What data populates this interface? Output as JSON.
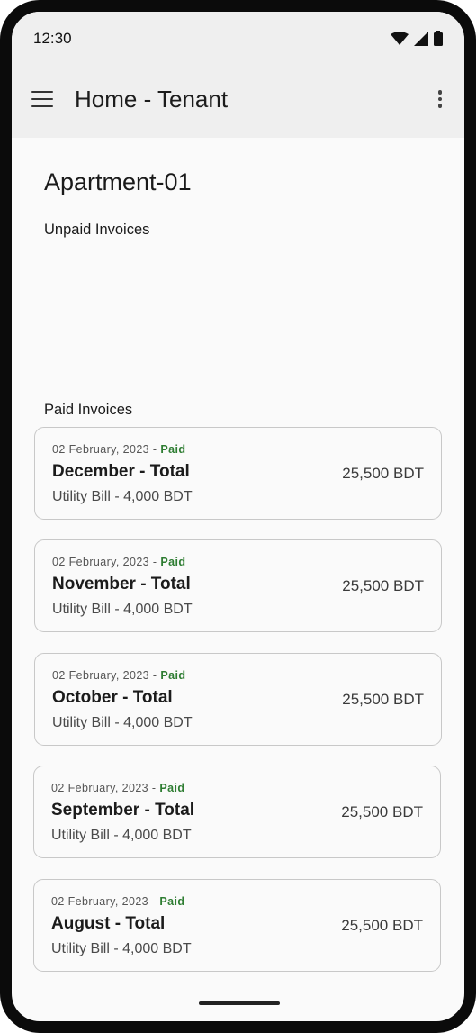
{
  "status_bar": {
    "time": "12:30",
    "icons": [
      "wifi-icon",
      "cellular-signal-icon",
      "battery-icon"
    ]
  },
  "app_bar": {
    "title": "Home - Tenant",
    "menu_icon": "hamburger-menu-icon",
    "more_icon": "more-vertical-icon"
  },
  "page": {
    "apartment": "Apartment-01",
    "unpaid_label": "Unpaid Invoices",
    "paid_label": "Paid Invoices"
  },
  "paid_invoices": [
    {
      "date": "02 February, 2023",
      "sep": "-",
      "status": "Paid",
      "title": "December - Total",
      "amount": "25,500 BDT",
      "utility": "Utility Bill - 4,000 BDT"
    },
    {
      "date": "02 February, 2023",
      "sep": "-",
      "status": "Paid",
      "title": "November - Total",
      "amount": "25,500 BDT",
      "utility": "Utility Bill - 4,000 BDT"
    },
    {
      "date": "02 February, 2023",
      "sep": "-",
      "status": "Paid",
      "title": "October - Total",
      "amount": "25,500 BDT",
      "utility": "Utility Bill - 4,000 BDT"
    },
    {
      "date": "02 February, 2023",
      "sep": "-",
      "status": "Paid",
      "title": "September - Total",
      "amount": "25,500 BDT",
      "utility": "Utility Bill - 4,000 BDT"
    },
    {
      "date": "02 February, 2023",
      "sep": "-",
      "status": "Paid",
      "title": "August - Total",
      "amount": "25,500 BDT",
      "utility": "Utility Bill - 4,000 BDT"
    }
  ],
  "colors": {
    "paid_status": "#2e7d32",
    "app_bar_bg": "#efefef",
    "page_bg": "#fafafa",
    "card_border": "#c8c8c8"
  }
}
